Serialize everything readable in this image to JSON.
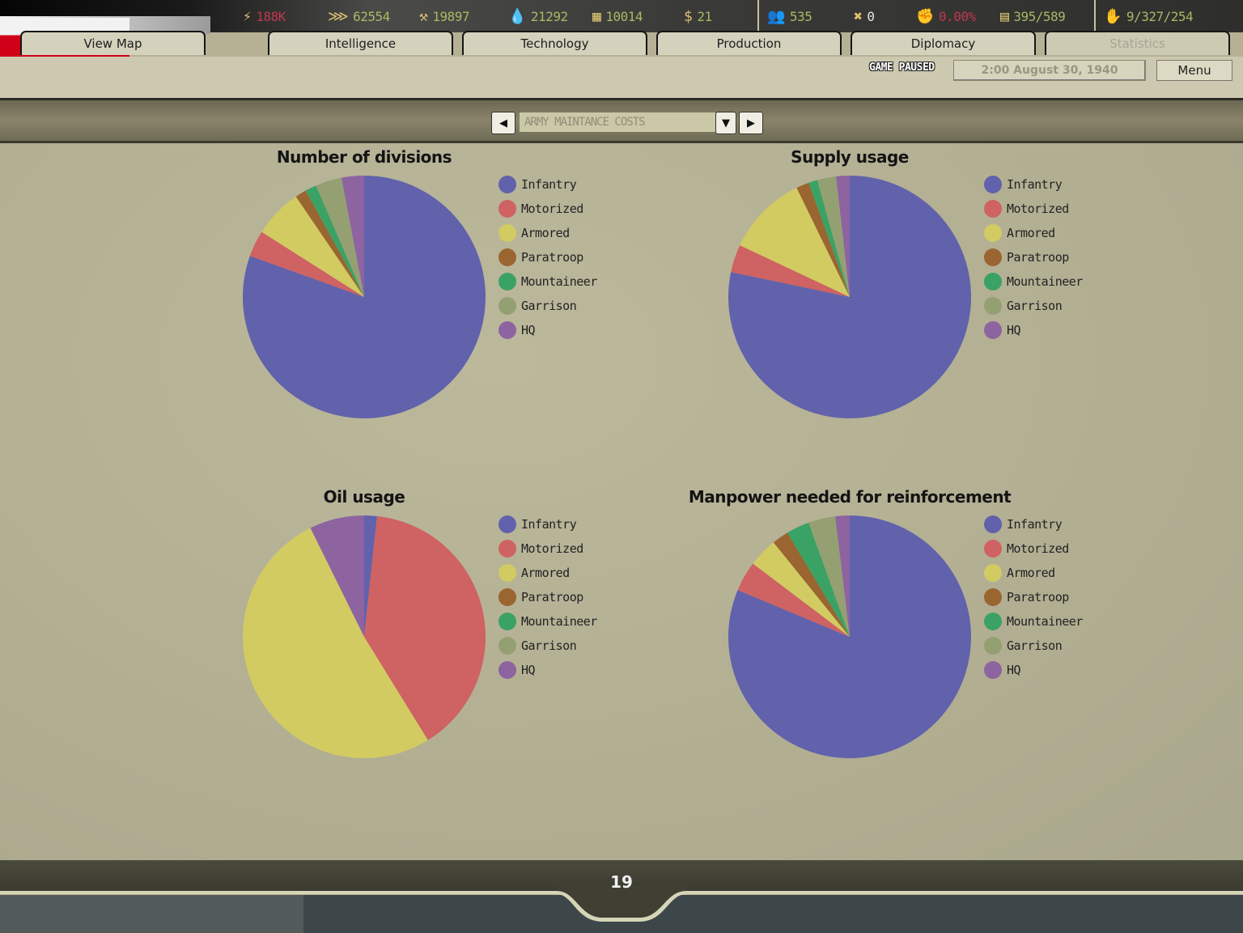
{
  "resources": [
    {
      "icon": "energy-icon",
      "glyph": "⚡",
      "value": "188K",
      "color": "#c0384f"
    },
    {
      "icon": "metal-icon",
      "glyph": "⋙",
      "value": "62554",
      "color": "#a7b964"
    },
    {
      "icon": "rare-materials-icon",
      "glyph": "⚒",
      "value": "19897",
      "color": "#a7b964"
    },
    {
      "icon": "oil-icon",
      "glyph": "💧",
      "value": "21292",
      "color": "#a7b964"
    },
    {
      "icon": "supplies-icon",
      "glyph": "▦",
      "value": "10014",
      "color": "#a7b964"
    },
    {
      "icon": "money-icon",
      "glyph": "$",
      "value": "21",
      "color": "#a7b964"
    },
    {
      "icon": "manpower-icon",
      "glyph": "👥",
      "value": "535",
      "color": "#a7b964"
    },
    {
      "icon": "diplomacy-icon",
      "glyph": "✖",
      "value": "0",
      "color": "#e8e8e8"
    },
    {
      "icon": "dissent-icon",
      "glyph": "✊",
      "value": "0.00%",
      "color": "#c0384f"
    },
    {
      "icon": "transport-icon",
      "glyph": "▤",
      "value": "395/589",
      "color": "#a7b964"
    },
    {
      "icon": "national-unity-icon",
      "glyph": "✋",
      "value": "9/327/254",
      "color": "#a7b964"
    }
  ],
  "tabs": [
    {
      "label": "View Map",
      "active": false
    },
    {
      "label": "Intelligence",
      "active": false
    },
    {
      "label": "Technology",
      "active": false
    },
    {
      "label": "Production",
      "active": false
    },
    {
      "label": "Diplomacy",
      "active": false
    },
    {
      "label": "Statistics",
      "active": true
    }
  ],
  "status": {
    "paused_label": "GAME PAUSED",
    "date": "2:00 August 30, 1940",
    "menu_label": "Menu"
  },
  "selector": {
    "prev_glyph": "◀",
    "next_glyph": "▶",
    "dropdown_glyph": "▼",
    "value": "ARMY MAINTANCE COSTS"
  },
  "legend_colors": {
    "Infantry": "#6162ab",
    "Motorized": "#cf6262",
    "Armored": "#d2cb62",
    "Paratroop": "#9a6530",
    "Mountaineer": "#3aa264",
    "Garrison": "#95a072",
    "HQ": "#8d64a0"
  },
  "chart_data": [
    {
      "type": "pie",
      "title": "Number of divisions",
      "categories": [
        "Infantry",
        "Motorized",
        "Armored",
        "Paratroop",
        "Mountaineer",
        "Garrison",
        "HQ"
      ],
      "values": [
        80.5,
        3.5,
        6.5,
        1.5,
        1.5,
        3.5,
        3.0
      ],
      "legend": "right"
    },
    {
      "type": "pie",
      "title": "Supply usage",
      "categories": [
        "Infantry",
        "Motorized",
        "Armored",
        "Paratroop",
        "Mountaineer",
        "Garrison",
        "HQ"
      ],
      "values": [
        78.3,
        3.7,
        10.8,
        1.7,
        1.2,
        2.5,
        1.8
      ],
      "legend": "right"
    },
    {
      "type": "pie",
      "title": "Oil usage",
      "categories": [
        "Infantry",
        "Motorized",
        "Armored",
        "Paratroop",
        "Mountaineer",
        "Garrison",
        "HQ"
      ],
      "values": [
        1.7,
        39.5,
        51.5,
        0,
        0,
        0,
        7.3
      ],
      "legend": "right"
    },
    {
      "type": "pie",
      "title": "Manpower needed for reinforcement",
      "categories": [
        "Infantry",
        "Motorized",
        "Armored",
        "Paratroop",
        "Mountaineer",
        "Garrison",
        "HQ"
      ],
      "values": [
        81.3,
        4.0,
        3.9,
        2.2,
        3.1,
        3.6,
        1.9
      ],
      "legend": "right"
    }
  ],
  "footer": {
    "page_number": "19"
  }
}
